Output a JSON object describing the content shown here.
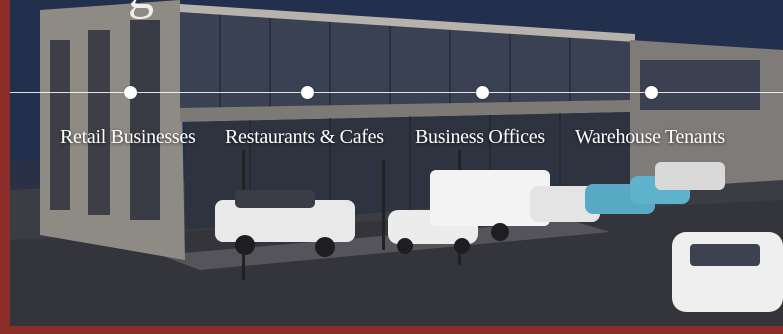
{
  "headline_fragment": "g",
  "timeline": {
    "items": [
      {
        "label": "Retail Businesses"
      },
      {
        "label": "Restaurants & Cafes"
      },
      {
        "label": "Business Offices"
      },
      {
        "label": "Warehouse Tenants"
      }
    ]
  },
  "colors": {
    "frame": "#8b2e2a",
    "text": "#ffffff"
  }
}
